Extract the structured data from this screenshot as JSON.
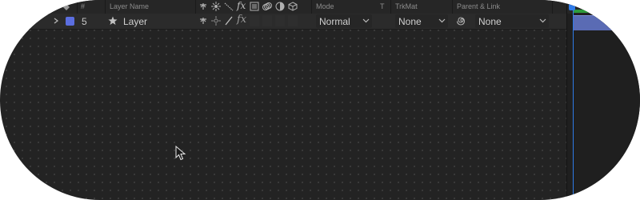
{
  "colors": {
    "panel_bg": "#232323",
    "header_bg": "#262626",
    "row_bg": "#2b2b2b",
    "label_color": "#5b6ee0",
    "layer_bar": "#5a6bb4",
    "work_area": "#2e9b3a",
    "playhead": "#2f7be8"
  },
  "header": {
    "number": "#",
    "layer_name": "Layer Name",
    "mode": "Mode",
    "t": "T",
    "trkmat": "TrkMat",
    "parent_link": "Parent & Link",
    "switch_icons": [
      "shy-icon",
      "collapse-icon",
      "quality-icon",
      "fx-icon",
      "frame-blend-icon",
      "motion-blur-icon",
      "adjustment-icon",
      "3d-icon"
    ]
  },
  "layer": {
    "number": "5",
    "name": "Layer",
    "mode": "Normal",
    "trkmat": "None",
    "parent": "None",
    "switch_icons": [
      "shy-icon",
      "collapse-icon",
      "quality-icon",
      "fx-icon"
    ]
  }
}
